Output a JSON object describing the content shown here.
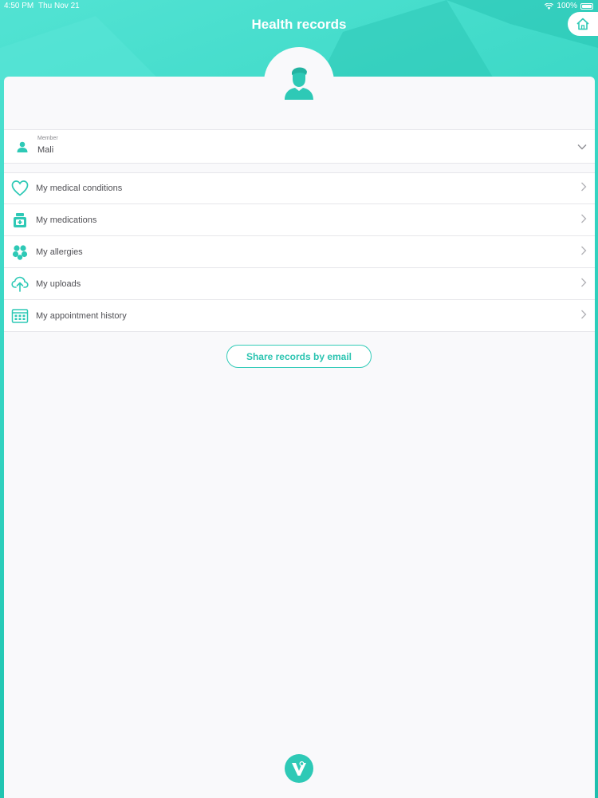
{
  "status_bar": {
    "time": "4:50 PM",
    "date": "Thu Nov 21",
    "battery": "100%"
  },
  "header": {
    "title": "Health records"
  },
  "member": {
    "label": "Member",
    "value": "Mali"
  },
  "menu": {
    "items": [
      {
        "label": "My medical conditions",
        "icon": "heart-icon"
      },
      {
        "label": "My medications",
        "icon": "medication-icon"
      },
      {
        "label": "My allergies",
        "icon": "allergy-icon"
      },
      {
        "label": "My uploads",
        "icon": "upload-cloud-icon"
      },
      {
        "label": "My appointment history",
        "icon": "calendar-icon"
      }
    ]
  },
  "share_button": {
    "label": "Share records by email"
  },
  "colors": {
    "accent": "#2ec9b6",
    "background": "#f9f9fb",
    "text": "#505055"
  }
}
